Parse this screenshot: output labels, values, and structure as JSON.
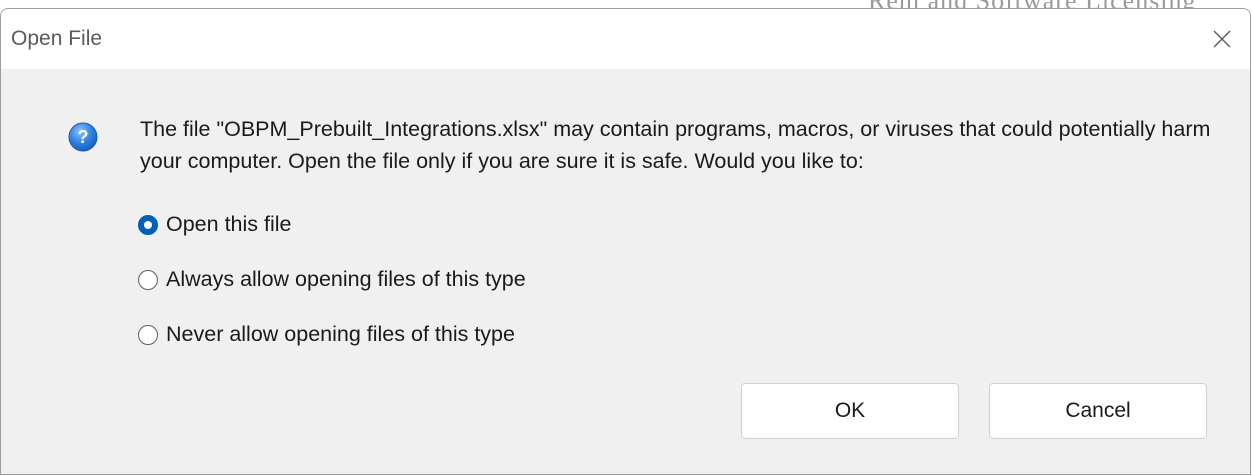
{
  "background": {
    "partial_text": "Rem and Software Licensing"
  },
  "dialog": {
    "title": "Open File",
    "close_icon": "close-icon",
    "help_icon": "question-mark-icon",
    "message": "The file \"OBPM_Prebuilt_Integrations.xlsx\" may contain programs, macros, or viruses that could potentially harm your computer. Open the file only if you are sure it is safe. Would you like to:",
    "options": [
      {
        "label": "Open this file",
        "selected": true
      },
      {
        "label": "Always allow opening files of this type",
        "selected": false
      },
      {
        "label": "Never allow opening files of this type",
        "selected": false
      }
    ],
    "ok_label": "OK",
    "cancel_label": "Cancel"
  },
  "colors": {
    "accent": "#005fb8",
    "dialog_bg": "#f0f0f0",
    "titlebar_bg": "#ffffff",
    "text": "#1a1a1a"
  }
}
